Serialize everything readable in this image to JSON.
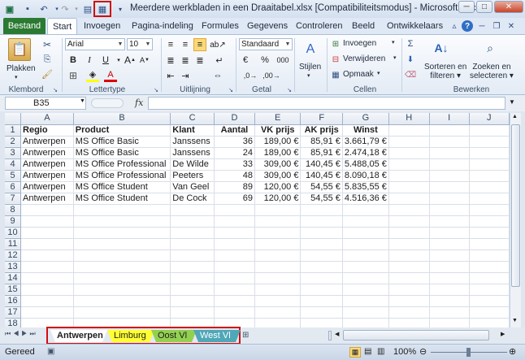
{
  "window": {
    "title": "Meerdere werkbladen in een Draaitabel.xlsx  [Compatibiliteitsmodus]  -  Microsoft Excel"
  },
  "ribbon": {
    "tabs": [
      "Bestand",
      "Start",
      "Invoegen",
      "Pagina-indeling",
      "Formules",
      "Gegevens",
      "Controleren",
      "Beeld",
      "Ontwikkelaars"
    ],
    "clipboard": {
      "paste_label": "Plakken",
      "group_label": "Klembord"
    },
    "font": {
      "name": "Arial",
      "size": "10",
      "group_label": "Lettertype",
      "bold": "B",
      "italic": "I",
      "underline": "U"
    },
    "alignment": {
      "group_label": "Uitlijning"
    },
    "number": {
      "format": "Standaard",
      "currency": "€",
      "percent": "%",
      "thousands": "000",
      "group_label": "Getal"
    },
    "styles": {
      "label": "Stijlen"
    },
    "cells": {
      "insert": "Invoegen",
      "delete": "Verwijderen",
      "format": "Opmaak",
      "group_label": "Cellen"
    },
    "editing": {
      "sort_line1": "Sorteren en",
      "sort_line2": "filteren",
      "find_line1": "Zoeken en",
      "find_line2": "selecteren",
      "group_label": "Bewerken"
    }
  },
  "formula_bar": {
    "name_box": "B35",
    "fx": "fx",
    "formula": ""
  },
  "sheet": {
    "columns": [
      "A",
      "B",
      "C",
      "D",
      "E",
      "F",
      "G",
      "H",
      "I",
      "J"
    ],
    "rows": [
      [
        "Regio",
        "Product",
        "Klant",
        "Aantal",
        "VK prijs",
        "AK prijs",
        "Winst",
        "",
        "",
        ""
      ],
      [
        "Antwerpen",
        "MS Office Basic",
        "Janssens",
        "36",
        "189,00 €",
        "85,91 €",
        "3.661,79 €",
        "",
        "",
        ""
      ],
      [
        "Antwerpen",
        "MS Office Basic",
        "Janssens",
        "24",
        "189,00 €",
        "85,91 €",
        "2.474,18 €",
        "",
        "",
        ""
      ],
      [
        "Antwerpen",
        "MS Office Professional",
        "De Wilde",
        "33",
        "309,00 €",
        "140,45 €",
        "5.488,05 €",
        "",
        "",
        ""
      ],
      [
        "Antwerpen",
        "MS Office Professional",
        "Peeters",
        "48",
        "309,00 €",
        "140,45 €",
        "8.090,18 €",
        "",
        "",
        ""
      ],
      [
        "Antwerpen",
        "MS Office Student",
        "Van Geel",
        "89",
        "120,00 €",
        "54,55 €",
        "5.835,55 €",
        "",
        "",
        ""
      ],
      [
        "Antwerpen",
        "MS Office Student",
        "De Cock",
        "69",
        "120,00 €",
        "54,55 €",
        "4.516,36 €",
        "",
        "",
        ""
      ],
      [
        "",
        "",
        "",
        "",
        "",
        "",
        "",
        "",
        "",
        ""
      ],
      [
        "",
        "",
        "",
        "",
        "",
        "",
        "",
        "",
        "",
        ""
      ],
      [
        "",
        "",
        "",
        "",
        "",
        "",
        "",
        "",
        "",
        ""
      ],
      [
        "",
        "",
        "",
        "",
        "",
        "",
        "",
        "",
        "",
        ""
      ],
      [
        "",
        "",
        "",
        "",
        "",
        "",
        "",
        "",
        "",
        ""
      ],
      [
        "",
        "",
        "",
        "",
        "",
        "",
        "",
        "",
        "",
        ""
      ],
      [
        "",
        "",
        "",
        "",
        "",
        "",
        "",
        "",
        "",
        ""
      ],
      [
        "",
        "",
        "",
        "",
        "",
        "",
        "",
        "",
        "",
        ""
      ],
      [
        "",
        "",
        "",
        "",
        "",
        "",
        "",
        "",
        "",
        ""
      ],
      [
        "",
        "",
        "",
        "",
        "",
        "",
        "",
        "",
        "",
        ""
      ],
      [
        "",
        "",
        "",
        "",
        "",
        "",
        "",
        "",
        "",
        ""
      ]
    ],
    "tabs": [
      {
        "label": "Antwerpen",
        "color": "#ffffff"
      },
      {
        "label": "Limburg",
        "color": "#ffff33"
      },
      {
        "label": "Oost Vl",
        "color": "#92d050"
      },
      {
        "label": "West Vl",
        "color": "#4fa7b8"
      }
    ]
  },
  "status": {
    "ready": "Gereed",
    "zoom": "100%"
  },
  "colors": {
    "accent_highlight": "#d10f0f",
    "file_tab": "#2b7a32"
  }
}
